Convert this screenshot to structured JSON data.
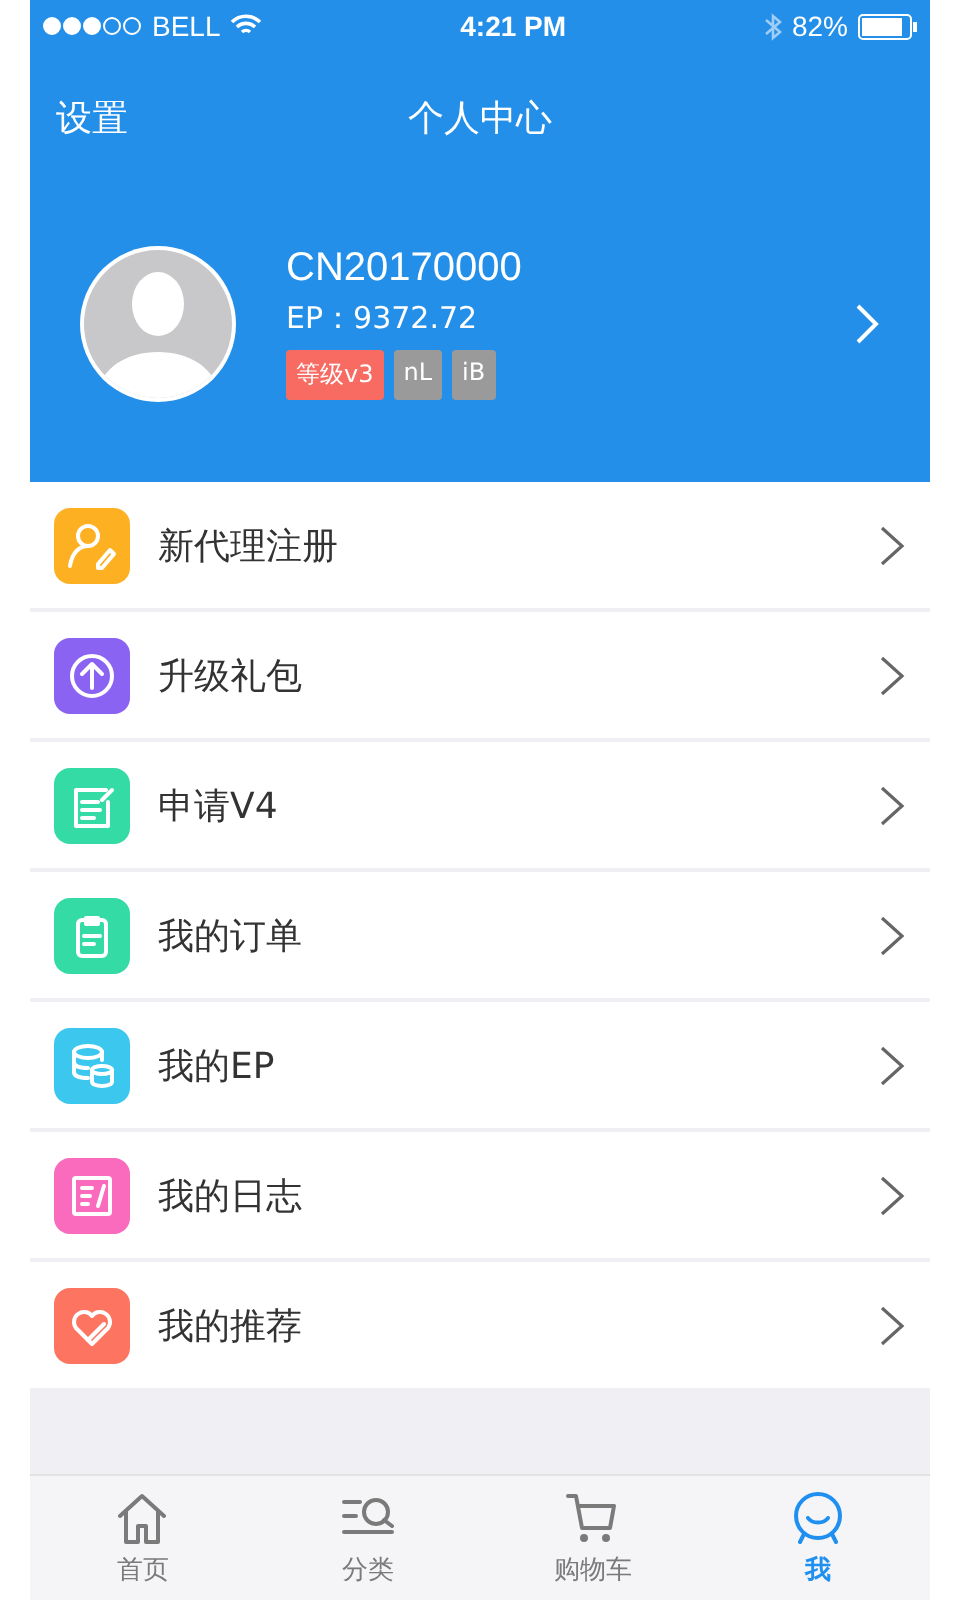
{
  "status_bar": {
    "carrier": "BELL",
    "time": "4:21 PM",
    "battery": "82%"
  },
  "nav_bar": {
    "left": "设置",
    "title": "个人中心"
  },
  "profile": {
    "user_id": "CN20170000",
    "ep": "EP：9372.72",
    "badges": [
      {
        "label": "等级v3",
        "color": "#f76b63"
      },
      {
        "label": "nL",
        "color": "#9a9a9a"
      },
      {
        "label": "iB",
        "color": "#9a9a9a"
      }
    ]
  },
  "menu": [
    {
      "label": "新代理注册",
      "kind": "register",
      "color": "#fdb022"
    },
    {
      "label": "升级礼包",
      "kind": "upgrade",
      "color": "#8a63f2"
    },
    {
      "label": "申请V4",
      "kind": "apply",
      "color": "#34dba4"
    },
    {
      "label": "我的订单",
      "kind": "orders",
      "color": "#34dba4"
    },
    {
      "label": "我的EP",
      "kind": "ep",
      "color": "#3cc8ee"
    },
    {
      "label": "我的日志",
      "kind": "log",
      "color": "#fb6bbd"
    },
    {
      "label": "我的推荐",
      "kind": "recommend",
      "color": "#fd7560"
    }
  ],
  "tab_bar": [
    {
      "label": "首页",
      "kind": "home",
      "selected": false
    },
    {
      "label": "分类",
      "kind": "category",
      "selected": false
    },
    {
      "label": "购物车",
      "kind": "cart",
      "selected": false
    },
    {
      "label": "我",
      "kind": "me",
      "selected": true
    }
  ]
}
